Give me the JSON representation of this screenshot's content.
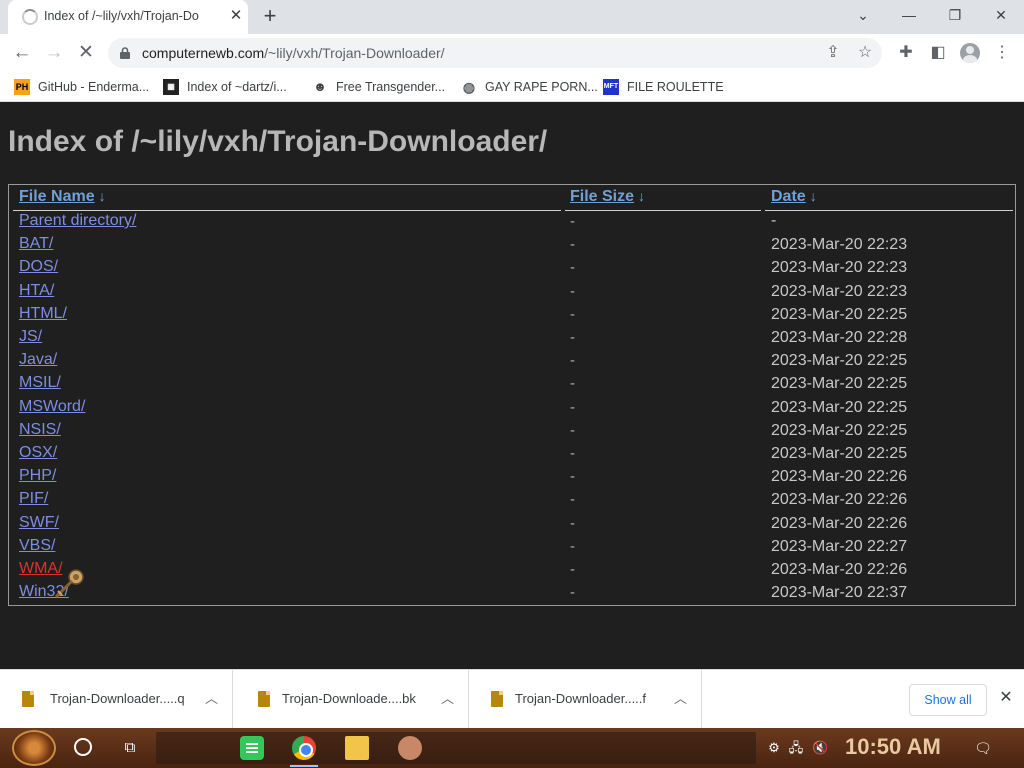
{
  "browser": {
    "tab_title": "Index of /~lily/vxh/Trojan-Do",
    "tab_close": "✕",
    "new_tab": "+",
    "url_domain": "computernewb.com",
    "url_path": "/~lily/vxh/Trojan-Downloader/",
    "bookmarks": [
      {
        "label": "GitHub - Enderma...",
        "icon": "ph-favicon"
      },
      {
        "label": "Index of ~dartz/i...",
        "icon": "qr-favicon"
      },
      {
        "label": "Free Transgender...",
        "icon": "mask-favicon"
      },
      {
        "label": "GAY RAPE PORN...",
        "icon": "globe-favicon"
      },
      {
        "label": "FILE ROULETTE",
        "icon": "mft-favicon"
      }
    ]
  },
  "page": {
    "title": "Index of /~lily/vxh/Trojan-Downloader/",
    "columns": {
      "name": "File Name",
      "size": "File Size",
      "date": "Date",
      "sort_arrow": "↓"
    },
    "rows": [
      {
        "name": "Parent directory/",
        "size": "-",
        "date": "-"
      },
      {
        "name": "BAT/",
        "size": "-",
        "date": "2023-Mar-20 22:23"
      },
      {
        "name": "DOS/",
        "size": "-",
        "date": "2023-Mar-20 22:23"
      },
      {
        "name": "HTA/",
        "size": "-",
        "date": "2023-Mar-20 22:23"
      },
      {
        "name": "HTML/",
        "size": "-",
        "date": "2023-Mar-20 22:25"
      },
      {
        "name": "JS/",
        "size": "-",
        "date": "2023-Mar-20 22:28"
      },
      {
        "name": "Java/",
        "size": "-",
        "date": "2023-Mar-20 22:25"
      },
      {
        "name": "MSIL/",
        "size": "-",
        "date": "2023-Mar-20 22:25"
      },
      {
        "name": "MSWord/",
        "size": "-",
        "date": "2023-Mar-20 22:25"
      },
      {
        "name": "NSIS/",
        "size": "-",
        "date": "2023-Mar-20 22:25"
      },
      {
        "name": "OSX/",
        "size": "-",
        "date": "2023-Mar-20 22:25"
      },
      {
        "name": "PHP/",
        "size": "-",
        "date": "2023-Mar-20 22:26"
      },
      {
        "name": "PIF/",
        "size": "-",
        "date": "2023-Mar-20 22:26"
      },
      {
        "name": "SWF/",
        "size": "-",
        "date": "2023-Mar-20 22:26"
      },
      {
        "name": "VBS/",
        "size": "-",
        "date": "2023-Mar-20 22:27"
      },
      {
        "name": "WMA/",
        "size": "-",
        "date": "2023-Mar-20 22:26",
        "hovered": true
      },
      {
        "name": "Win32/",
        "size": "-",
        "date": "2023-Mar-20 22:37"
      }
    ]
  },
  "downloads": {
    "items": [
      {
        "name": "Trojan-Downloader.....q"
      },
      {
        "name": "Trojan-Downloade....bk"
      },
      {
        "name": "Trojan-Downloader.....f"
      }
    ],
    "show_all": "Show all",
    "close": "✕"
  },
  "taskbar": {
    "clock": "10:50 AM",
    "notification_count": "4"
  },
  "colors": {
    "page_bg": "#1f1f1f",
    "link": "#7e8ee0",
    "header_link": "#6fa0d8",
    "hover_link": "#e03030",
    "taskbar": "#5a2e16"
  }
}
